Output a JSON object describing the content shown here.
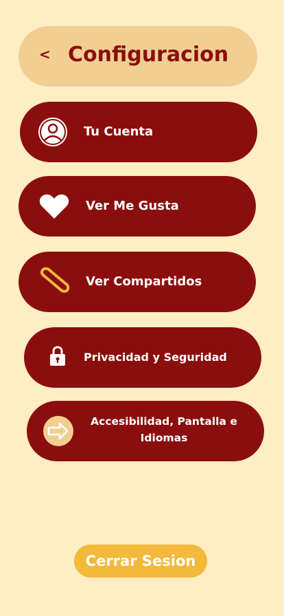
{
  "header": {
    "back_label": "<",
    "title": "Configuracion"
  },
  "menu": [
    {
      "label": "Tu Cuenta",
      "icon": "user-icon"
    },
    {
      "label": "Ver Me Gusta",
      "icon": "heart-icon"
    },
    {
      "label": "Ver Compartidos",
      "icon": "paperclip-icon"
    },
    {
      "label": "Privacidad y Seguridad",
      "icon": "lock-icon"
    },
    {
      "label": "Accesibilidad, Pantalla e Idiomas",
      "icon": "arrow-right-circle-icon"
    }
  ],
  "logout_label": "Cerrar Sesion",
  "colors": {
    "background": "#FFEDC4",
    "header": "#F1CF93",
    "primary": "#8B0E0E",
    "accent": "#F2B93B"
  }
}
